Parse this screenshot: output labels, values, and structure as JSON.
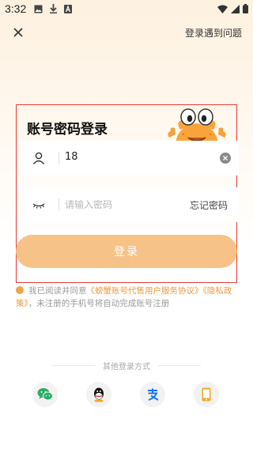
{
  "status_bar": {
    "time": "3:32",
    "left_icons": [
      "image-icon",
      "download-icon",
      "font-icon"
    ],
    "right_icons": [
      "wifi-icon",
      "signal-icon",
      "battery-icon"
    ]
  },
  "top_bar": {
    "close_icon": "close-icon",
    "help_label": "登录遇到问题"
  },
  "login_panel": {
    "title": "账号密码登录",
    "phone": {
      "icon": "user-icon",
      "value": "18",
      "clear_icon": "clear-circle-icon"
    },
    "password": {
      "icon": "eye-closed-icon",
      "placeholder": "请输入密码",
      "forgot_label": "忘记密码"
    },
    "login_button_label": "登录",
    "highlight_color": "#e53935"
  },
  "agreement": {
    "prefix": "我已阅读并同意",
    "link_service": "《螃蟹账号代售用户服务协议》",
    "link_privacy": "《隐私政策》",
    "suffix": "，未注册的手机号将自动完成账号注册"
  },
  "other_login": {
    "title": "其他登录方式",
    "methods": [
      {
        "icon": "wechat-icon",
        "color": "#2aae67"
      },
      {
        "icon": "qq-icon",
        "color": "#111111"
      },
      {
        "icon": "alipay-icon",
        "color": "#1677ff"
      },
      {
        "icon": "phone-icon",
        "color": "#f5a623"
      }
    ]
  },
  "colors": {
    "accent": "#f0993d",
    "button": "#f7c287"
  }
}
